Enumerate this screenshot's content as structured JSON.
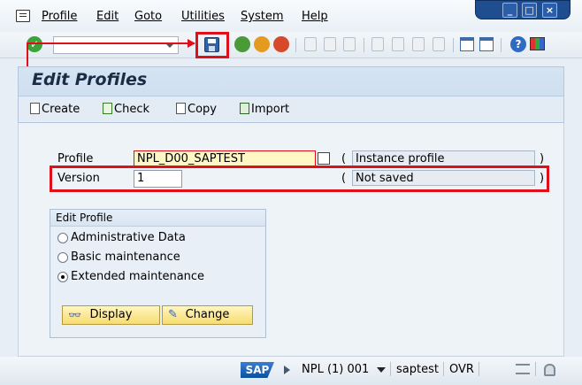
{
  "menu": {
    "items": [
      "Profile",
      "Edit",
      "Goto",
      "Utilities",
      "System",
      "Help"
    ]
  },
  "window_controls": [
    "minimize",
    "maximize",
    "close"
  ],
  "toolbar": {
    "command_field_value": "",
    "icons": [
      "enter-icon",
      "save-icon",
      "back-icon",
      "exit-icon",
      "cancel-icon",
      "print-icon",
      "find-icon",
      "find-next-icon",
      "first-page-icon",
      "previous-page-icon",
      "next-page-icon",
      "last-page-icon",
      "create-session-icon",
      "shortcut-icon",
      "help-icon",
      "customize-layout-icon"
    ]
  },
  "page": {
    "title": "Edit Profiles"
  },
  "app_toolbar": {
    "create": "Create",
    "check": "Check",
    "copy": "Copy",
    "import": "Import"
  },
  "form": {
    "profile_label": "Profile",
    "profile_value": "NPL_D00_SAPTEST",
    "profile_type": "Instance profile",
    "version_label": "Version",
    "version_value": "1",
    "version_status": "Not saved",
    "open_paren": "(",
    "close_paren": ")"
  },
  "edit_profile": {
    "title": "Edit Profile",
    "options": [
      "Administrative Data",
      "Basic maintenance",
      "Extended maintenance"
    ],
    "selected_index": 2,
    "display_label": "Display",
    "change_label": "Change"
  },
  "status": {
    "logo": "SAP",
    "system": "NPL (1) 001",
    "server": "saptest",
    "mode": "OVR"
  },
  "colors": {
    "highlight": "#e0101a",
    "title_panel": "#c9dbee",
    "button": "#f7dc70"
  }
}
